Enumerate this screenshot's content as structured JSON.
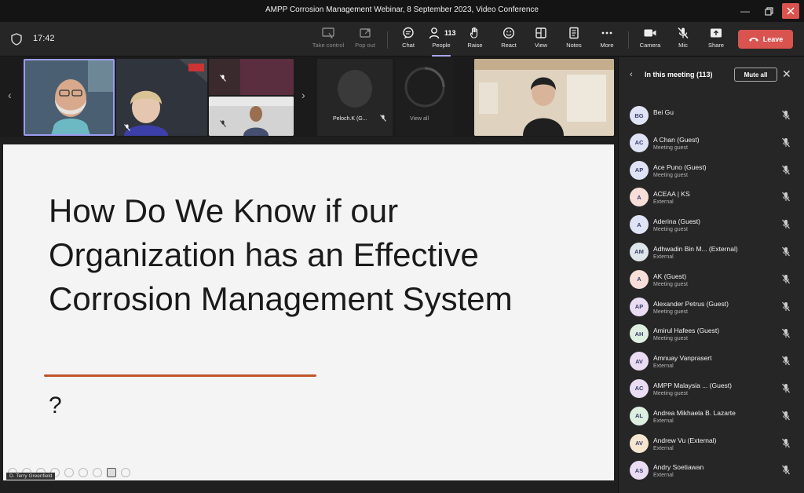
{
  "window": {
    "title": "AMPP Corrosion Management Webinar, 8 September 2023, Video Conference"
  },
  "toolbar": {
    "time": "17:42",
    "buttons": [
      {
        "label": "Take control",
        "icon": "take-control-icon"
      },
      {
        "label": "Pop out",
        "icon": "pop-out-icon"
      },
      {
        "label": "Chat",
        "icon": "chat-icon"
      },
      {
        "label": "People",
        "icon": "people-icon",
        "count": "113"
      },
      {
        "label": "Raise",
        "icon": "raise-hand-icon"
      },
      {
        "label": "React",
        "icon": "react-icon"
      },
      {
        "label": "View",
        "icon": "view-icon"
      },
      {
        "label": "Notes",
        "icon": "notes-icon"
      },
      {
        "label": "More",
        "icon": "more-icon"
      },
      {
        "label": "Camera",
        "icon": "camera-icon"
      },
      {
        "label": "Mic",
        "icon": "mic-off-icon"
      },
      {
        "label": "Share",
        "icon": "share-icon"
      }
    ],
    "leave_label": "Leave"
  },
  "strip": {
    "tiles": [
      {
        "name": ""
      },
      {
        "name": ""
      },
      {
        "name": ""
      },
      {
        "name": ""
      },
      {
        "name": "Peloch.K (G..."
      },
      {
        "name": "View all"
      },
      {
        "name": ""
      }
    ]
  },
  "slide": {
    "title": "How Do We Know if our Organization has an Effective Corrosion Management System",
    "question": "?",
    "presenter": "D. Terry Greenfield"
  },
  "panel": {
    "title": "In this meeting (113)",
    "mute_all": "Mute all",
    "participants": [
      {
        "initials": "BG",
        "name": "Bei Gu",
        "sub": "",
        "color": "#dfe3f5"
      },
      {
        "initials": "AC",
        "name": "A Chan (Guest)",
        "sub": "Meeting guest",
        "color": "#dfe3f5"
      },
      {
        "initials": "AP",
        "name": "Ace Puno (Guest)",
        "sub": "Meeting guest",
        "color": "#dfe3f5"
      },
      {
        "initials": "A",
        "name": "ACEAA | KS",
        "sub": "External",
        "color": "#f7ded9"
      },
      {
        "initials": "A",
        "name": "Aderina (Guest)",
        "sub": "Meeting guest",
        "color": "#dfe3f5"
      },
      {
        "initials": "AM",
        "name": "Adhwadin Bin M...  (External)",
        "sub": "External",
        "color": "#dfe6ea"
      },
      {
        "initials": "A",
        "name": "AK (Guest)",
        "sub": "Meeting guest",
        "color": "#f7ded9"
      },
      {
        "initials": "AP",
        "name": "Alexander Petrus (Guest)",
        "sub": "Meeting guest",
        "color": "#eadcf2"
      },
      {
        "initials": "AH",
        "name": "Amirul Hafees (Guest)",
        "sub": "Meeting guest",
        "color": "#dcefe0"
      },
      {
        "initials": "AV",
        "name": "Amnuay Vanprasert",
        "sub": "External",
        "color": "#eadcf2"
      },
      {
        "initials": "AC",
        "name": "AMPP Malaysia ...  (Guest)",
        "sub": "Meeting guest",
        "color": "#eadcf2"
      },
      {
        "initials": "AL",
        "name": "Andrea Mikhaela B. Lazarte",
        "sub": "External",
        "color": "#dcefe0"
      },
      {
        "initials": "AV",
        "name": "Andrew Vu (External)",
        "sub": "External",
        "color": "#f5e6d0"
      },
      {
        "initials": "AS",
        "name": "Andry Soetiawan",
        "sub": "External",
        "color": "#eadcf2"
      }
    ]
  }
}
